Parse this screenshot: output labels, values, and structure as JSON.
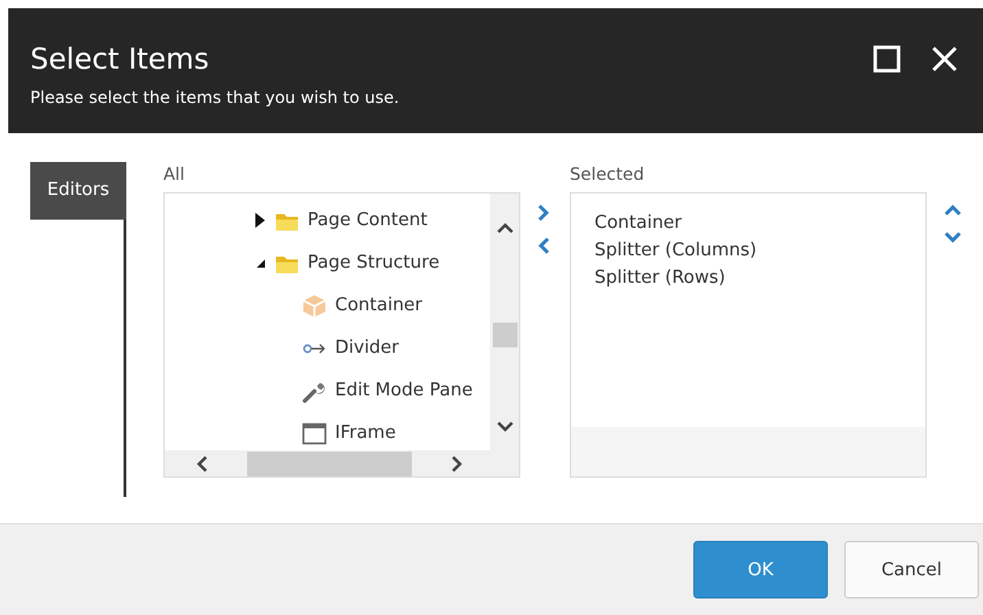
{
  "window": {
    "title": "Select Items",
    "subtitle": "Please select the items that you wish to use."
  },
  "tabs": [
    {
      "label": "Editors",
      "selected": true
    }
  ],
  "all": {
    "label": "All",
    "tree": [
      {
        "label": "Page Content",
        "kind": "folder",
        "expanded": false
      },
      {
        "label": "Page Structure",
        "kind": "folder",
        "expanded": true,
        "children": [
          {
            "label": "Container",
            "kind": "box"
          },
          {
            "label": "Divider",
            "kind": "link"
          },
          {
            "label": "Edit Mode Pane",
            "kind": "wrench"
          },
          {
            "label": "IFrame",
            "kind": "frame"
          }
        ]
      }
    ]
  },
  "selected": {
    "label": "Selected",
    "items": [
      "Container",
      "Splitter (Columns)",
      "Splitter (Rows)"
    ]
  },
  "buttons": [
    {
      "label": "OK",
      "kind": "primary"
    },
    {
      "label": "Cancel",
      "kind": "secondary"
    }
  ]
}
